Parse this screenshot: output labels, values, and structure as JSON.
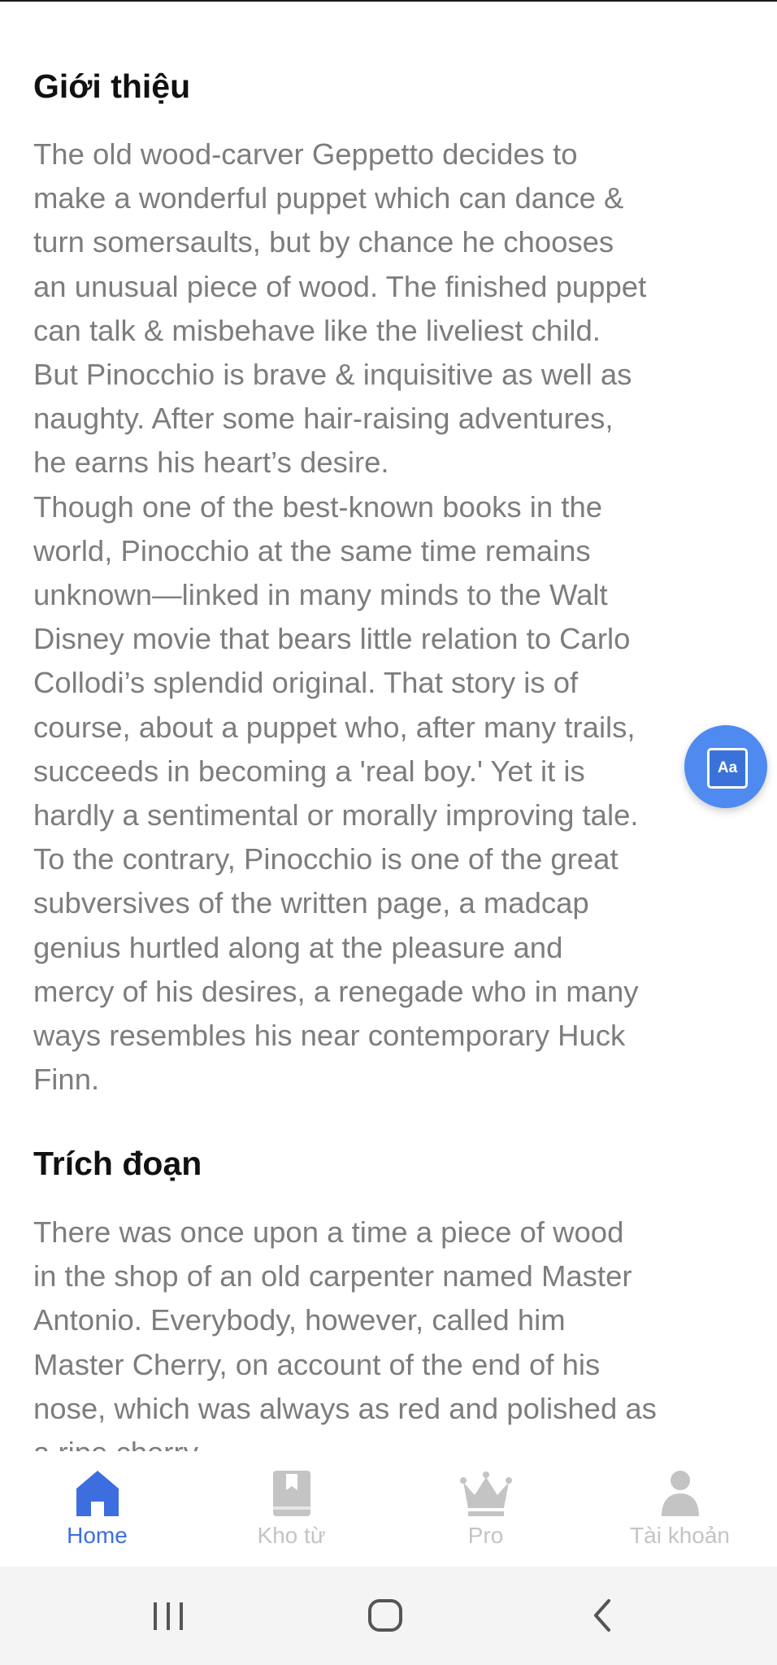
{
  "intro": {
    "title": "Giới thiệu",
    "lines": [
      "The old wood-carver Geppetto decides to",
      "make a wonderful puppet which can dance &",
      "turn somersaults, but by chance he chooses",
      "an unusual piece of wood. The finished puppet",
      "can talk & misbehave like the liveliest child.",
      "But Pinocchio is brave & inquisitive as well as",
      "naughty. After some hair-raising adventures,",
      "he earns his heart’s desire.",
      "Though one of the best-known books in the",
      "world, Pinocchio at the same time remains",
      "unknown—linked in many minds to the Walt",
      "Disney movie that bears little relation to Carlo",
      "Collodi’s splendid original. That story is of",
      "course, about a puppet who, after many trails,",
      "succeeds in becoming a 'real boy.' Yet it is",
      "hardly a sentimental or morally improving tale.",
      "To the contrary, Pinocchio is one of the great",
      "subversives of the written page, a madcap",
      "genius hurtled along at the pleasure and",
      "mercy of his desires, a renegade who in many",
      "ways resembles his near contemporary Huck",
      "Finn."
    ]
  },
  "excerpt": {
    "title": "Trích đoạn",
    "lines": [
      "There was once upon a time a piece of wood",
      "in the shop of an old carpenter named Master",
      "Antonio. Everybody, however, called him",
      "Master Cherry, on account of the end of his",
      "nose, which was always as red and polished as",
      "a ripe cherry."
    ]
  },
  "fab": {
    "icon": "font-size-icon",
    "label": "Aa"
  },
  "tabs": [
    {
      "label": "Home",
      "icon": "home-icon",
      "active": true
    },
    {
      "label": "Kho từ",
      "icon": "book-icon",
      "active": false
    },
    {
      "label": "Pro",
      "icon": "crown-icon",
      "active": false
    },
    {
      "label": "Tài khoản",
      "icon": "user-icon",
      "active": false
    }
  ],
  "colors": {
    "accent": "#3d6ee0",
    "fab": "#4f8af0",
    "body_text": "#7d7d7d",
    "inactive": "#c4c4c4"
  }
}
